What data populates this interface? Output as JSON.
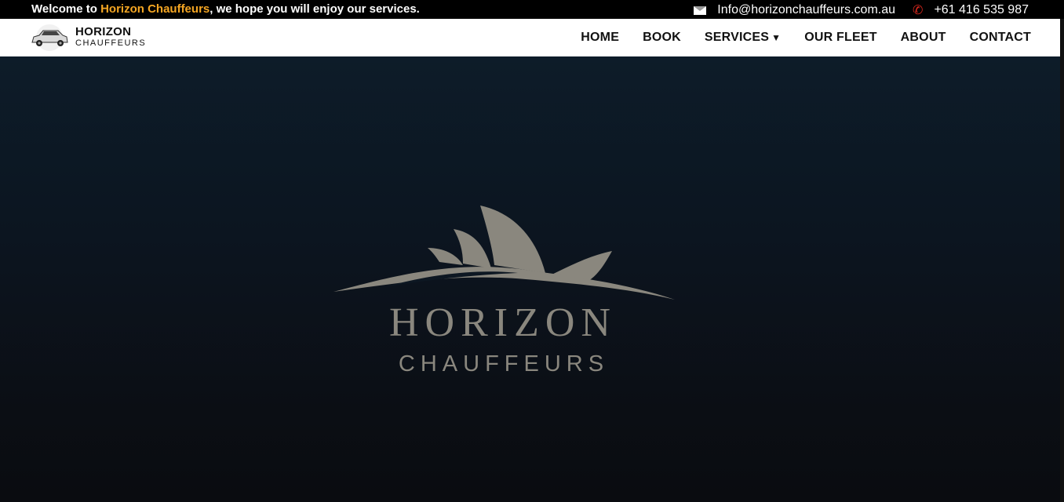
{
  "topbar": {
    "welcome_prefix": "Welcome to ",
    "welcome_brand": "Horizon Chauffeurs",
    "welcome_suffix": ", we hope you will enjoy our services.",
    "email": "Info@horizonchauffeurs.com.au",
    "phone": "+61 416 535 987",
    "email_icon": "envelope-icon",
    "phone_icon": "phone-icon"
  },
  "logo": {
    "title": "HORIZON",
    "subtitle": "CHAUFFEURS",
    "icon": "car-icon"
  },
  "nav": {
    "items": [
      {
        "label": "HOME"
      },
      {
        "label": "BOOK"
      },
      {
        "label": "SERVICES",
        "dropdown": true
      },
      {
        "label": "OUR FLEET"
      },
      {
        "label": "ABOUT"
      },
      {
        "label": "CONTACT"
      }
    ]
  },
  "hero": {
    "title": "HORIZON",
    "subtitle": "CHAUFFEURS",
    "emblem": "opera-house-logo"
  },
  "colors": {
    "brand_accent": "#f5a623",
    "phone_icon": "#e0281e",
    "hero_logo": "#8a877e"
  }
}
